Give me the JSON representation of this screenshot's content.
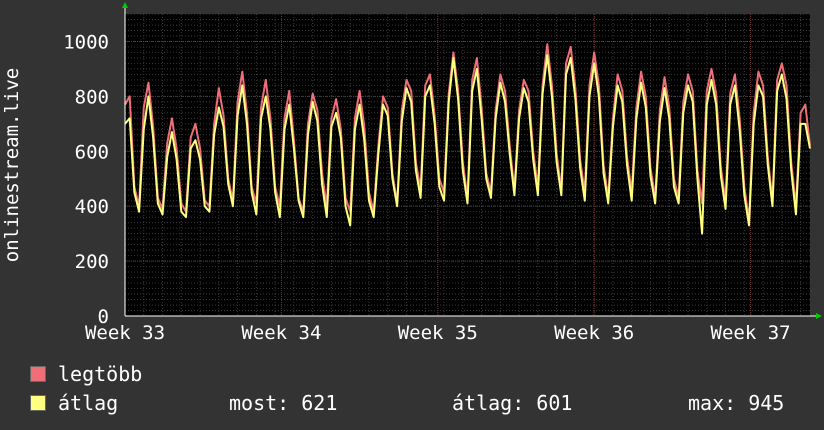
{
  "chart_data": {
    "type": "line",
    "ylabel": "onlinestream.live",
    "ylim": [
      0,
      1100
    ],
    "y_ticks": [
      0,
      200,
      400,
      600,
      800,
      1000
    ],
    "x_tick_labels": [
      "Week 33",
      "Week 34",
      "Week 35",
      "Week 36",
      "Week 37"
    ],
    "grid": true,
    "points_per_day": 4,
    "series": [
      {
        "name": "legtöbb",
        "color": "#ee6f78",
        "values": [
          770,
          800,
          470,
          400,
          760,
          850,
          690,
          430,
          390,
          630,
          720,
          610,
          410,
          380,
          650,
          700,
          610,
          420,
          400,
          700,
          830,
          730,
          500,
          420,
          780,
          890,
          740,
          470,
          410,
          760,
          860,
          720,
          470,
          400,
          720,
          820,
          640,
          430,
          380,
          700,
          810,
          750,
          520,
          400,
          720,
          790,
          680,
          430,
          380,
          720,
          820,
          690,
          450,
          380,
          620,
          800,
          760,
          520,
          410,
          750,
          860,
          820,
          560,
          460,
          840,
          880,
          730,
          500,
          450,
          810,
          960,
          820,
          560,
          430,
          860,
          940,
          760,
          520,
          450,
          750,
          880,
          820,
          620,
          460,
          750,
          860,
          820,
          600,
          470,
          840,
          990,
          840,
          590,
          460,
          920,
          980,
          830,
          570,
          450,
          840,
          960,
          840,
          550,
          430,
          720,
          880,
          820,
          580,
          450,
          760,
          890,
          800,
          540,
          430,
          750,
          870,
          760,
          500,
          430,
          780,
          880,
          820,
          530,
          410,
          820,
          900,
          810,
          540,
          420,
          810,
          880,
          720,
          470,
          350,
          740,
          890,
          840,
          580,
          420,
          860,
          920,
          840,
          560,
          400,
          740,
          770,
          620
        ]
      },
      {
        "name": "átlag",
        "color": "#ffff80",
        "values": [
          700,
          720,
          450,
          380,
          680,
          800,
          650,
          410,
          370,
          580,
          670,
          570,
          380,
          360,
          610,
          640,
          570,
          400,
          380,
          660,
          760,
          690,
          480,
          400,
          730,
          840,
          700,
          450,
          370,
          720,
          800,
          680,
          450,
          360,
          680,
          770,
          610,
          420,
          360,
          660,
          780,
          710,
          480,
          360,
          690,
          740,
          650,
          400,
          330,
          680,
          770,
          640,
          420,
          360,
          590,
          770,
          730,
          500,
          400,
          710,
          830,
          780,
          530,
          430,
          800,
          840,
          700,
          470,
          420,
          780,
          940,
          790,
          530,
          410,
          820,
          900,
          720,
          500,
          430,
          720,
          850,
          780,
          590,
          440,
          720,
          830,
          780,
          570,
          440,
          810,
          950,
          800,
          560,
          440,
          880,
          940,
          790,
          540,
          420,
          800,
          920,
          800,
          520,
          410,
          690,
          840,
          780,
          550,
          420,
          720,
          850,
          760,
          510,
          410,
          710,
          830,
          720,
          470,
          410,
          740,
          840,
          780,
          500,
          300,
          770,
          860,
          770,
          510,
          390,
          770,
          840,
          680,
          440,
          330,
          700,
          840,
          800,
          550,
          400,
          820,
          880,
          790,
          530,
          370,
          700,
          700,
          610
        ]
      }
    ],
    "legend_placement": "bottom-left"
  },
  "legend": {
    "max_label": "legtöbb",
    "avg_label": "átlag",
    "max_color": "#ee6f78",
    "avg_color": "#ffff80"
  },
  "stats": {
    "current": "most: 621",
    "average": "átlag: 601",
    "maximum": "max: 945"
  }
}
